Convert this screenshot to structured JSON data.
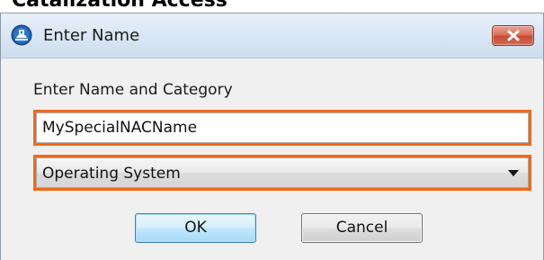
{
  "background": {
    "heading": "Catalization Access"
  },
  "dialog": {
    "title": "Enter Name",
    "title_icon": "app-cog-icon",
    "close_icon": "close-icon",
    "prompt": "Enter Name and Category",
    "name_input": {
      "value": "MySpecialNACName"
    },
    "category_select": {
      "selected": "Operating System"
    },
    "buttons": {
      "ok": "OK",
      "cancel": "Cancel"
    }
  },
  "colors": {
    "highlight": "#f06a15",
    "title_bar": "#dbe7f5",
    "close_button": "#c74b33",
    "ok_button": "#bee6fd"
  }
}
